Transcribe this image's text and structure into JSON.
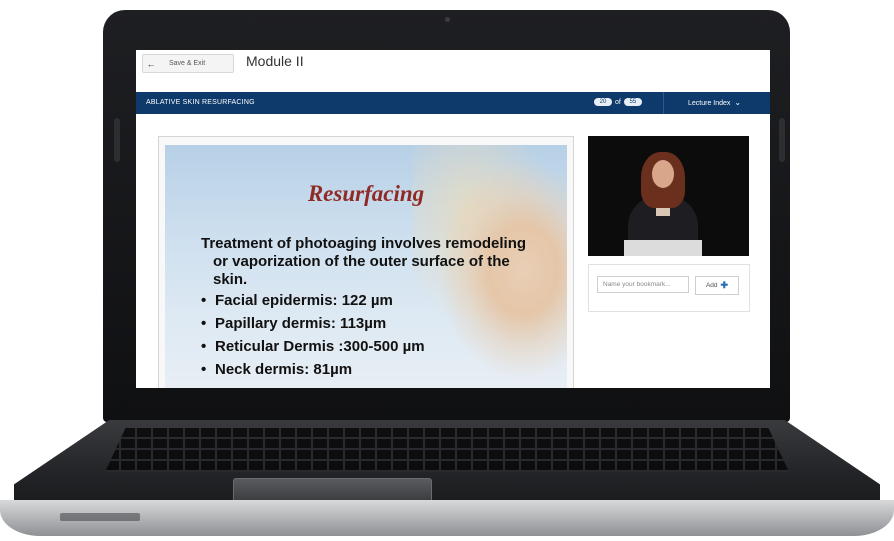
{
  "app": {
    "save_exit_label": "Save & Exit",
    "module_title": "Module II"
  },
  "nav": {
    "section_title": "ABLATIVE SKIN RESURFACING",
    "current_slide": "20",
    "of_label": "of",
    "total_slides": "55",
    "lecture_index_label": "Lecture Index"
  },
  "slide": {
    "title": "Resurfacing",
    "intro_line1": "Treatment of photoaging involves remodeling",
    "intro_line2": "or vaporization of the outer surface of the",
    "intro_line3": "skin.",
    "bullets": [
      "Facial epidermis:  122 µm",
      "Papillary dermis:  113µm",
      "Reticular Dermis :300-500 µm",
      "Neck dermis:   81µm"
    ]
  },
  "bookmark": {
    "placeholder": "Name your bookmark...",
    "add_label": "Add"
  },
  "colors": {
    "nav_bar": "#0d3a6b",
    "slide_title": "#8f2a25",
    "add_icon": "#2d6db3"
  }
}
